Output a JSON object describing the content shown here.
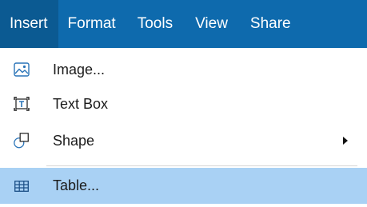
{
  "menubar": {
    "items": [
      {
        "label": "Insert",
        "active": true
      },
      {
        "label": "Format",
        "active": false
      },
      {
        "label": "Tools",
        "active": false
      },
      {
        "label": "View",
        "active": false
      },
      {
        "label": "Share",
        "active": false
      }
    ]
  },
  "dropdown": {
    "items": [
      {
        "label": "Image...",
        "icon": "image-icon"
      },
      {
        "label": "Text Box",
        "icon": "text-box-icon"
      },
      {
        "label": "Shape",
        "icon": "shape-icon",
        "has_submenu": true
      },
      {
        "label": "Table...",
        "icon": "table-icon",
        "highlighted": true
      }
    ]
  },
  "colors": {
    "menubar_bg": "#0e6aad",
    "menubar_active_bg": "#0b5a92",
    "highlight_bg": "#a9d1f4",
    "icon_blue": "#2a74b8"
  }
}
